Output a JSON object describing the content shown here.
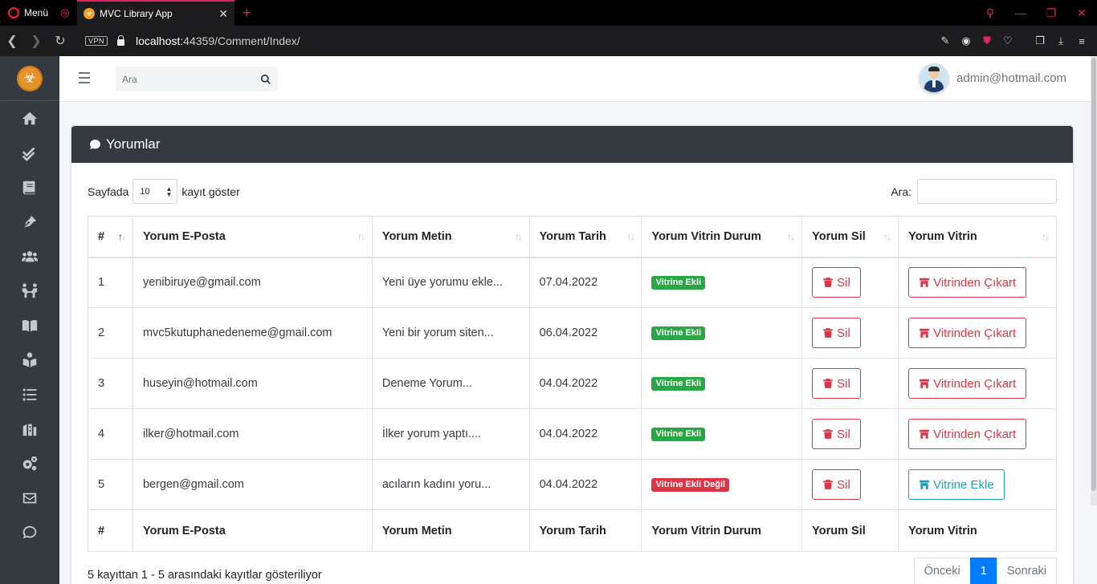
{
  "browser": {
    "menu_label": "Menü",
    "tab_title": "MVC Library App",
    "url_host": "localhost",
    "url_path": ":44359/Comment/Index/",
    "vpn_label": "VPN"
  },
  "navbar": {
    "search_placeholder": "Ara",
    "user_email": "admin@hotmail.com"
  },
  "sidebar": {
    "icons": [
      "home-icon",
      "check-double-icon",
      "book-icon",
      "pen-nib-icon",
      "users-icon",
      "people-carry-icon",
      "book-open-icon",
      "book-reader-icon",
      "list-icon",
      "library-icon",
      "cogs-icon",
      "envelope-icon",
      "comment-icon"
    ]
  },
  "card": {
    "title": "Yorumlar",
    "show_prefix": "Sayfada",
    "page_size": "10",
    "show_suffix": "kayıt göster",
    "filter_label": "Ara:"
  },
  "table": {
    "headers": [
      "#",
      "Yorum E-Posta",
      "Yorum Metin",
      "Yorum Tarih",
      "Yorum Vitrin Durum",
      "Yorum Sil",
      "Yorum Vitrin"
    ],
    "rows": [
      {
        "id": "1",
        "email": "yenibiruye@gmail.com",
        "text": "Yeni üye yorumu ekle...",
        "date": "07.04.2022",
        "status": "Vitrine Ekli",
        "delete": "Sil",
        "action": "Vitrinden Çıkart"
      },
      {
        "id": "2",
        "email": "mvc5kutuphanedeneme@gmail.com",
        "text": "Yeni bir yorum siten...",
        "date": "06.04.2022",
        "status": "Vitrine Ekli",
        "delete": "Sil",
        "action": "Vitrinden Çıkart"
      },
      {
        "id": "3",
        "email": "huseyin@hotmail.com",
        "text": "Deneme Yorum...",
        "date": "04.04.2022",
        "status": "Vitrine Ekli",
        "delete": "Sil",
        "action": "Vitrinden Çıkart"
      },
      {
        "id": "4",
        "email": "ilker@hotmail.com",
        "text": "İlker yorum yaptı....",
        "date": "04.04.2022",
        "status": "Vitrine Ekli",
        "delete": "Sil",
        "action": "Vitrinden Çıkart"
      },
      {
        "id": "5",
        "email": "bergen@gmail.com",
        "text": "acıların kadını yoru...",
        "date": "04.04.2022",
        "status": "Vitrine Ekli Değil",
        "delete": "Sil",
        "action": "Vitrine Ekle"
      }
    ]
  },
  "footer": {
    "info": "5 kayıttan 1 - 5 arasındaki kayıtlar gösteriliyor",
    "prev": "Önceki",
    "current_page": "1",
    "next": "Sonraki"
  },
  "colors": {
    "sidebar_bg": "#343a40",
    "danger": "#dc3545",
    "success": "#28a745",
    "info": "#17a2b8",
    "primary": "#007bff"
  }
}
